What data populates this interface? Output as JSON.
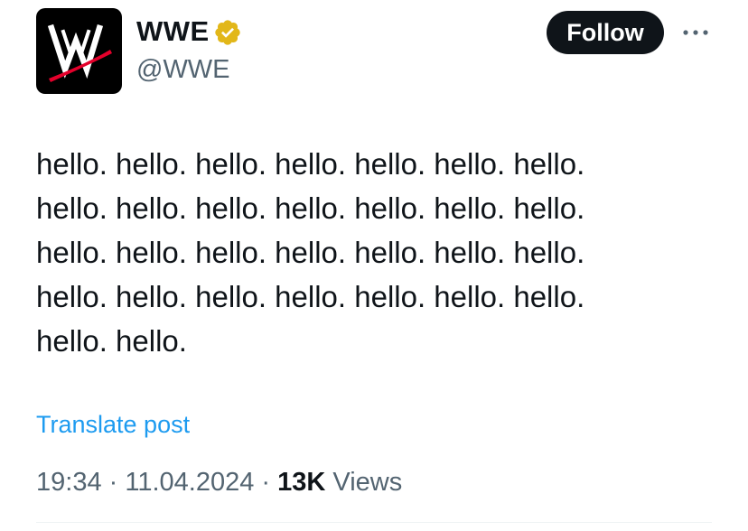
{
  "author": {
    "display_name": "WWE",
    "handle": "@WWE",
    "verified": true,
    "verified_color": "#e2b719",
    "avatar_icon": "wwe-logo-icon"
  },
  "actions": {
    "follow_label": "Follow",
    "more_icon": "more-options-icon"
  },
  "post": {
    "text": "hello. hello. hello. hello. hello. hello. hello.\nhello. hello. hello. hello. hello. hello. hello.\nhello. hello. hello. hello. hello. hello. hello.\nhello. hello. hello. hello. hello. hello. hello.\nhello. hello.",
    "translate_label": "Translate post"
  },
  "meta": {
    "time": "19:34",
    "separator": " · ",
    "date": "11.04.2024",
    "views_count": "13K",
    "views_label": " Views"
  },
  "colors": {
    "accent_link": "#1d9bf0",
    "text_primary": "#0f1419",
    "text_secondary": "#536471",
    "logo_red": "#e4002b"
  }
}
